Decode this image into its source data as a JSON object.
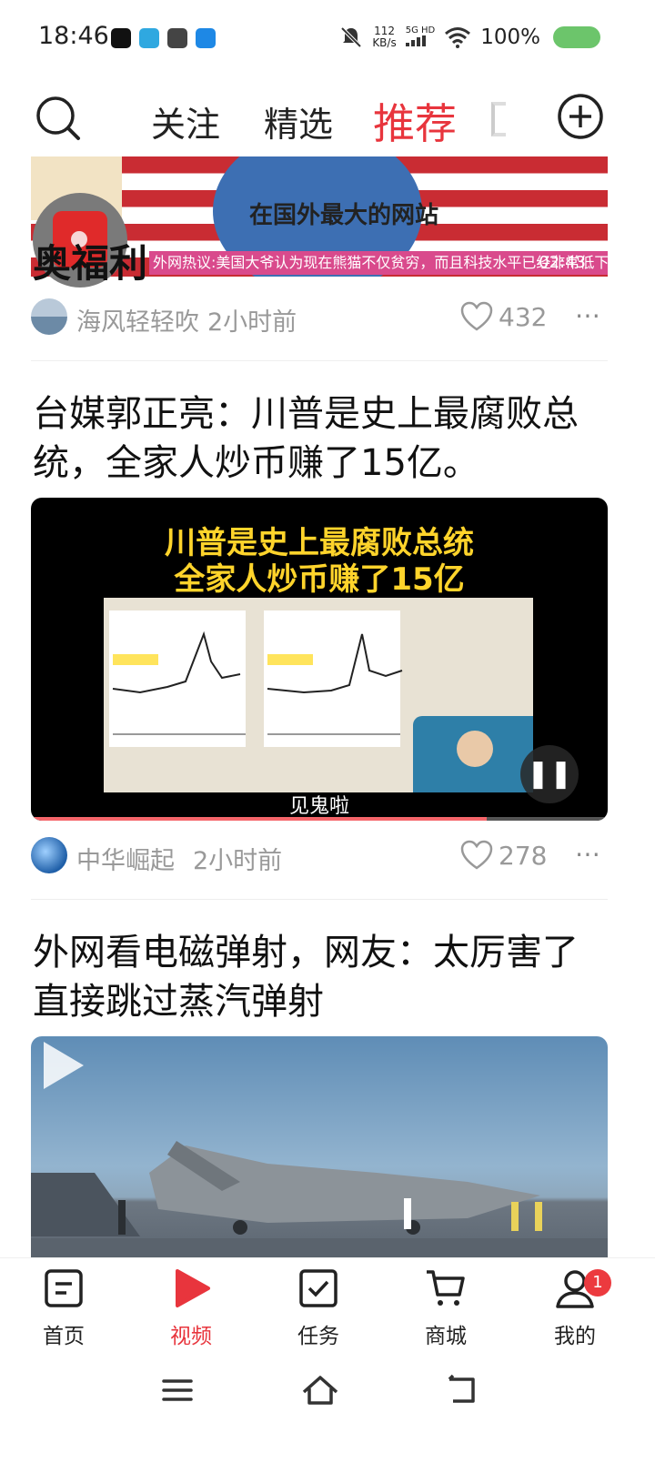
{
  "status_bar": {
    "time": "18:46",
    "net_speed_value": "112",
    "net_speed_unit": "KB/s",
    "network_type": "5G HD",
    "battery": "100%"
  },
  "top_tabs": [
    "关注",
    "精选",
    "推荐"
  ],
  "active_tab": "推荐",
  "feed": [
    {
      "thumbnail_caption": "在国外最大的网站",
      "thumbnail_ticker": "外网热议:美国大爷认为现在熊猫不仅贫穷，而且科技水平已经非常低下!",
      "thumbnail_duration": "02:43",
      "welfare_label": "奥福利",
      "author": "海风轻轻吹",
      "time_ago": "2小时前",
      "likes": "432"
    },
    {
      "title": "台媒郭正亮：川普是史上最腐败总统，全家人炒币赚了15亿。",
      "video_headline_1": "川普是史上最腐败总统",
      "video_headline_2": "全家人炒币赚了15亿",
      "video_subtitle": "见鬼啦",
      "progress": 0.79,
      "author": "中华崛起",
      "time_ago": "2小时前",
      "likes": "278"
    },
    {
      "title": "外网看电磁弹射，网友：太厉害了直接跳过蒸汽弹射"
    }
  ],
  "bottom_nav": [
    {
      "label": "首页",
      "icon": "home-doc-icon"
    },
    {
      "label": "视频",
      "icon": "video-play-icon"
    },
    {
      "label": "任务",
      "icon": "task-check-icon"
    },
    {
      "label": "商城",
      "icon": "cart-icon"
    },
    {
      "label": "我的",
      "icon": "profile-icon"
    }
  ],
  "profile_badge": "1",
  "colors": {
    "accent": "#e8353d",
    "muted_text": "#999999",
    "battery": "#6cc56b"
  }
}
